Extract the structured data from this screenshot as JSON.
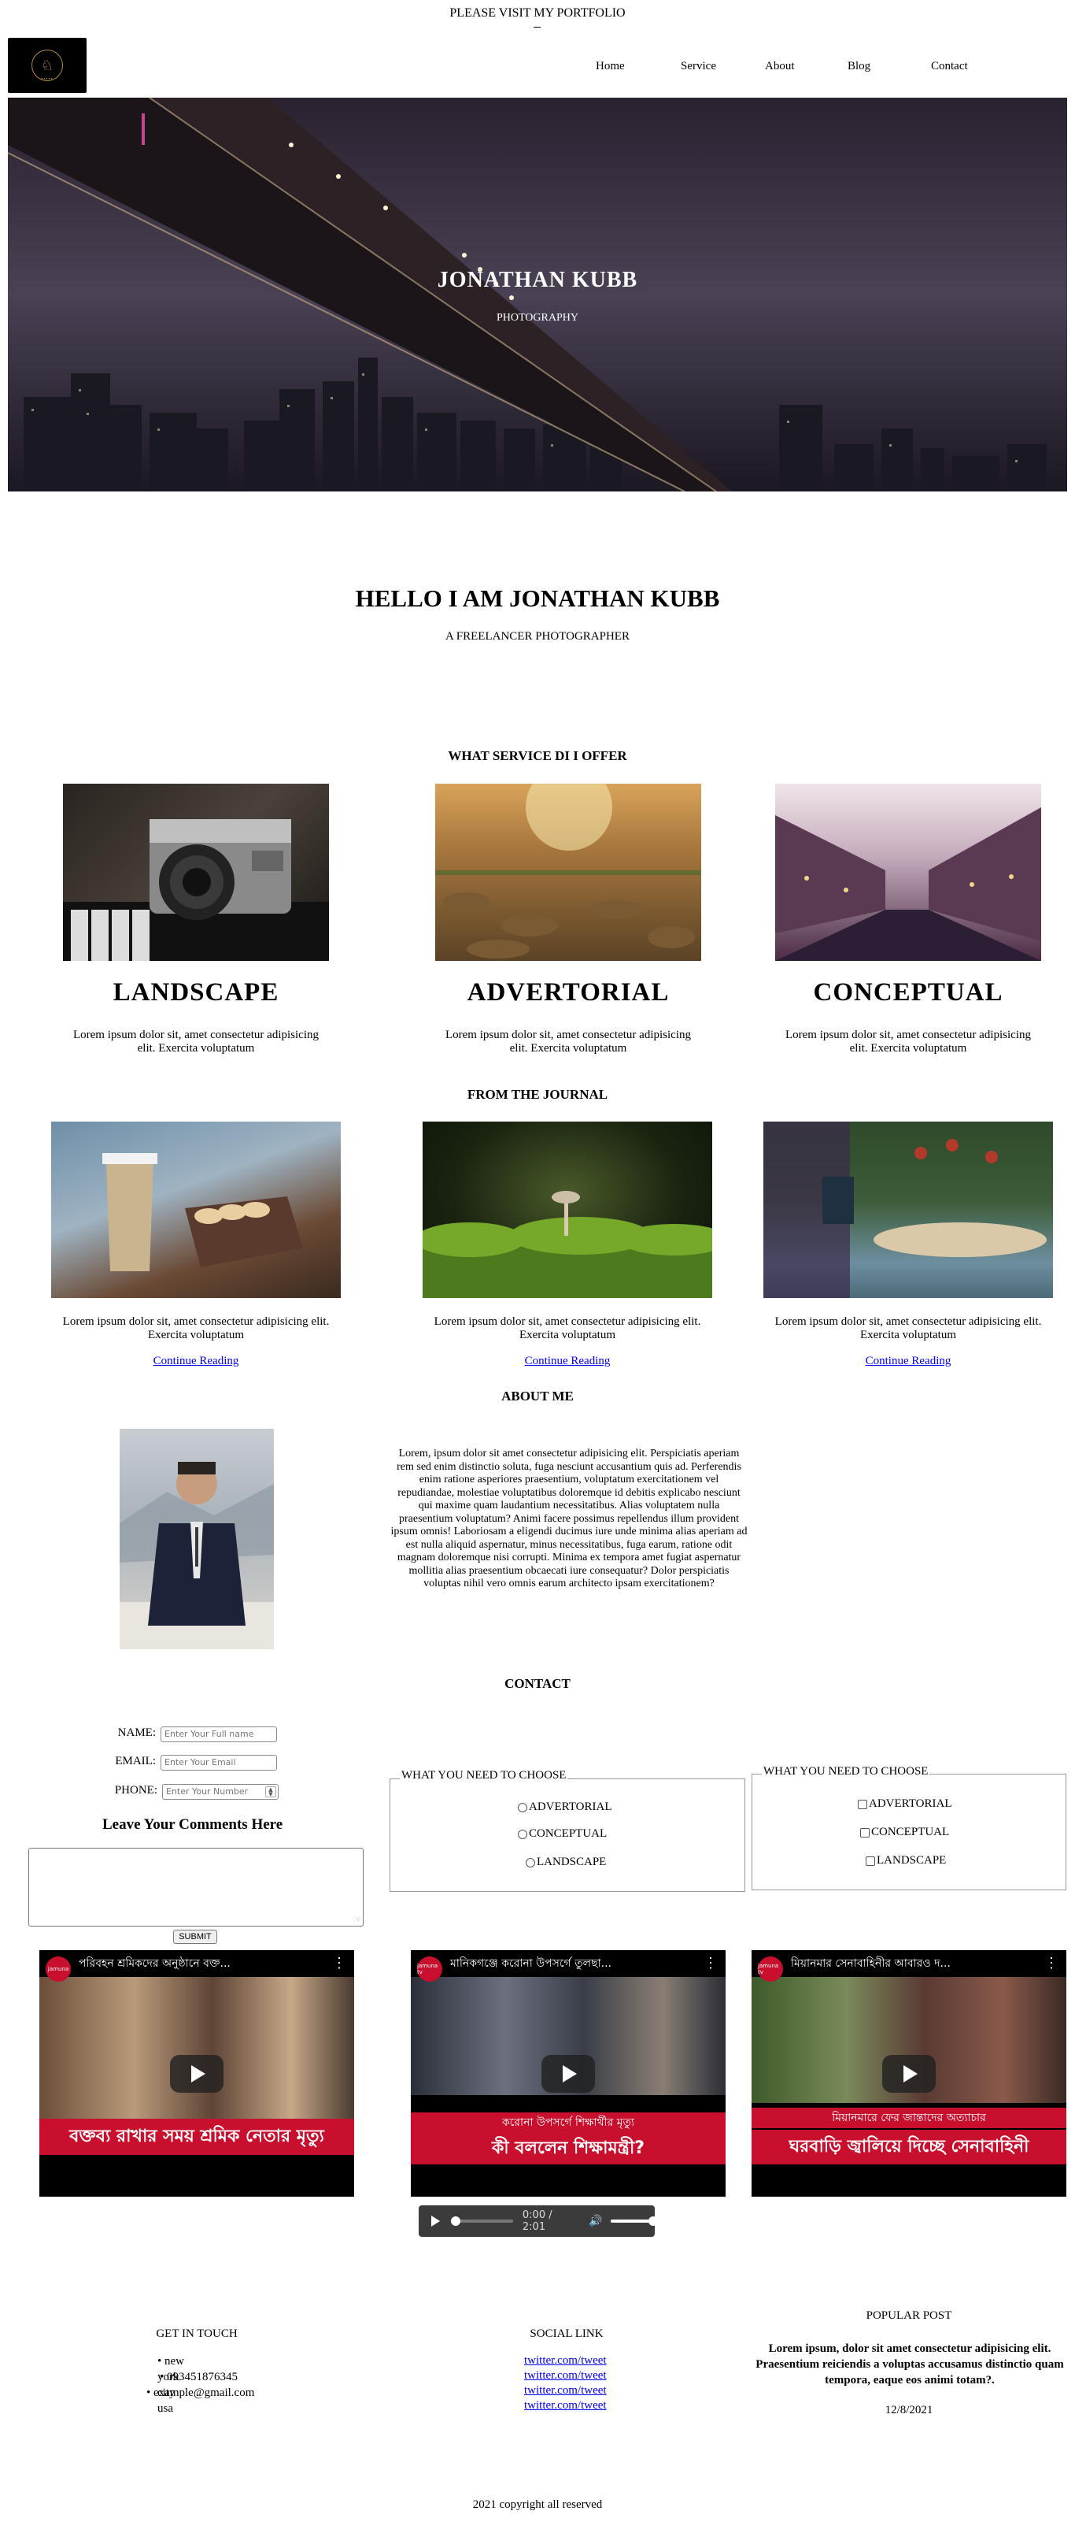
{
  "top_note": "PLEASE VISIT MY PORTFOLIO",
  "nav": {
    "items": [
      "Home",
      "Service",
      "About",
      "Blog",
      "Contact"
    ]
  },
  "hero": {
    "title": "JONATHAN KUBB",
    "subtitle": "PHOTOGRAPHY"
  },
  "intro": {
    "title": "HELLO I AM JONATHAN KUBB",
    "subtitle": "A FREELANCER PHOTOGRAPHER"
  },
  "services": {
    "heading": "WHAT SERVICE DI I OFFER",
    "items": [
      {
        "title": "LANDSCAPE",
        "text": "Lorem ipsum dolor sit, amet consectetur adipisicing elit. Exercita voluptatum"
      },
      {
        "title": "ADVERTORIAL",
        "text": "Lorem ipsum dolor sit, amet consectetur adipisicing elit. Exercita voluptatum"
      },
      {
        "title": "CONCEPTUAL",
        "text": "Lorem ipsum dolor sit, amet consectetur adipisicing elit. Exercita voluptatum"
      }
    ]
  },
  "journal": {
    "heading": "FROM THE JOURNAL",
    "items": [
      {
        "text": "Lorem ipsum dolor sit, amet consectetur adipisicing elit. Exercita voluptatum",
        "link": "Continue Reading"
      },
      {
        "text": "Lorem ipsum dolor sit, amet consectetur adipisicing elit. Exercita voluptatum",
        "link": "Continue Reading"
      },
      {
        "text": "Lorem ipsum dolor sit, amet consectetur adipisicing elit. Exercita voluptatum",
        "link": "Continue Reading"
      }
    ]
  },
  "about": {
    "heading": "ABOUT ME",
    "text": "Lorem, ipsum dolor sit amet consectetur adipisicing elit. Perspiciatis aperiam rem sed enim distinctio soluta, fuga nesciunt accusantium quis ad. Perferendis enim ratione asperiores praesentium, voluptatum exercitationem vel repudiandae, molestiae voluptatibus doloremque id debitis explicabo nesciunt qui maxime quam laudantium necessitatibus. Alias voluptatem nulla praesentium voluptatum? Animi facere possimus repellendus illum provident ipsum omnis! Laboriosam a eligendi ducimus iure unde minima alias aperiam ad est nulla aliquid aspernatur, minus necessitatibus, fuga earum, ratione odit magnam doloremque nisi corrupti. Minima ex tempora amet fugiat aspernatur mollitia alias praesentium obcaecati iure consequatur? Dolor perspiciatis voluptas nihil vero omnis earum architecto ipsam exercitationem?"
  },
  "contact": {
    "heading": "CONTACT",
    "name_label": "NAME:",
    "name_placeholder": "Enter Your Full name",
    "email_label": "EMAIL:",
    "email_placeholder": "Enter Your Email",
    "phone_label": "PHONE:",
    "phone_placeholder": "Enter Your Number",
    "comments_title": "Leave Your Comments Here",
    "submit_label": "SUBMIT",
    "radio_group": {
      "legend": "WHAT YOU NEED TO CHOOSE",
      "options": [
        "ADVERTORIAL",
        "CONCEPTUAL",
        "LANDSCAPE"
      ]
    },
    "check_group": {
      "legend": "WHAT YOU NEED TO CHOOSE",
      "options": [
        "ADVERTORIAL",
        "CONCEPTUAL",
        "LANDSCAPE"
      ]
    }
  },
  "videos": [
    {
      "title": "পরিবহন শ্রমিকদের অনুষ্ঠানে বক্ত...",
      "caption": "বক্তব্য রাখার সময় শ্রমিক নেতার মৃত্যু",
      "sub": "",
      "channel": "jamuna"
    },
    {
      "title": "মানিকগঞ্জে করোনা উপসর্গে তুলছা...",
      "caption": "কী বললেন শিক্ষামন্ত্রী?",
      "sub": "করোনা উপসর্গে শিক্ষার্থীর মৃত্যু",
      "channel": "jamuna tv"
    },
    {
      "title": "মিয়ানমার সেনাবাহিনীর আবারও দ...",
      "caption": "ঘরবাড়ি জ্বালিয়ে দিচ্ছে সেনাবাহিনী",
      "sub": "মিয়ানমারে ফের জান্তাদের অত্যাচার",
      "channel": "jamuna tv"
    }
  ],
  "audio": {
    "time": "0:00 / 2:01"
  },
  "footer": {
    "touch": {
      "title": "GET IN TOUCH",
      "items": [
        "new york city usa",
        "093451876345",
        "example@gmail.com"
      ]
    },
    "social": {
      "title": "SOCIAL LINK",
      "links": [
        "twitter.com/tweet",
        "twitter.com/tweet",
        "twitter.com/tweet",
        "twitter.com/tweet"
      ]
    },
    "popular": {
      "title": "POPULAR POST",
      "text": "Lorem ipsum, dolor sit amet consectetur adipisicing elit. Praesentium reiciendis a voluptas accusamus distinctio quam tempora, eaque eos animi totam?.",
      "date": "12/8/2021"
    },
    "copyright": "2021 copyright all reserved"
  }
}
